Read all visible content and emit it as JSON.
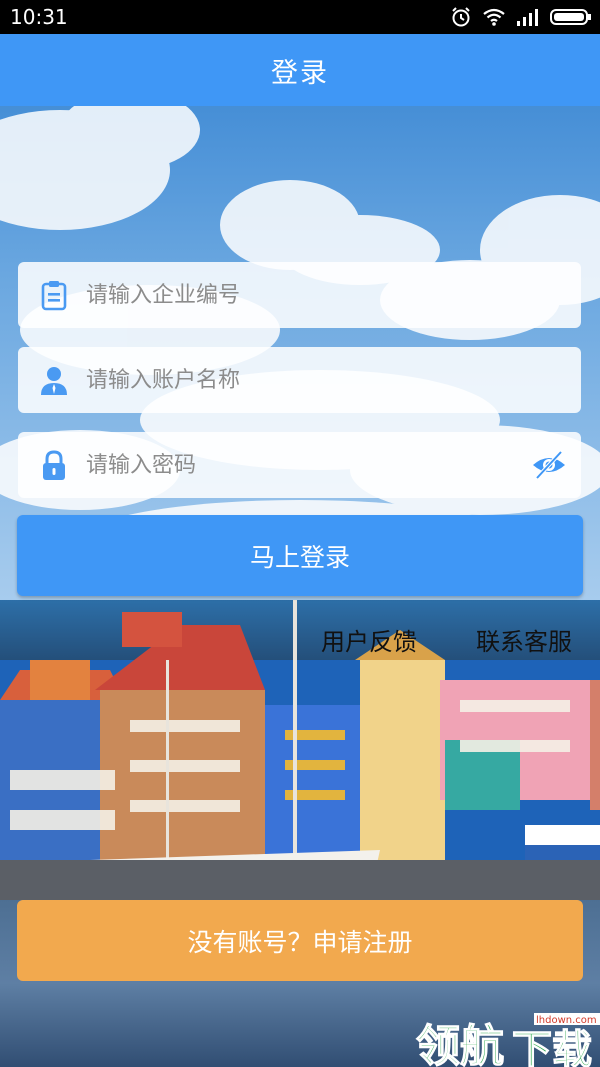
{
  "status_bar": {
    "time": "10:31",
    "icons": [
      "alarm-icon",
      "wifi-icon",
      "signal-icon",
      "battery-icon"
    ]
  },
  "header": {
    "title": "登录"
  },
  "form": {
    "company_id": {
      "placeholder": "请输入企业编号",
      "value": "",
      "icon": "clipboard-icon"
    },
    "account_name": {
      "placeholder": "请输入账户名称",
      "value": "",
      "icon": "user-icon"
    },
    "password": {
      "placeholder": "请输入密码",
      "value": "",
      "icon": "lock-icon",
      "toggle_icon": "eye-hidden-icon"
    }
  },
  "actions": {
    "login_label": "马上登录",
    "feedback_label": "用户反馈",
    "contact_label": "联系客服",
    "register_label": "没有账号？申请注册"
  },
  "watermark": {
    "brand_text": "领航下载",
    "site_text": "lhdown.com"
  },
  "colors": {
    "primary": "#3f97f6",
    "register": "#f2a94e",
    "icon": "#4a9af2",
    "watermark_green": "#2fa84f"
  }
}
